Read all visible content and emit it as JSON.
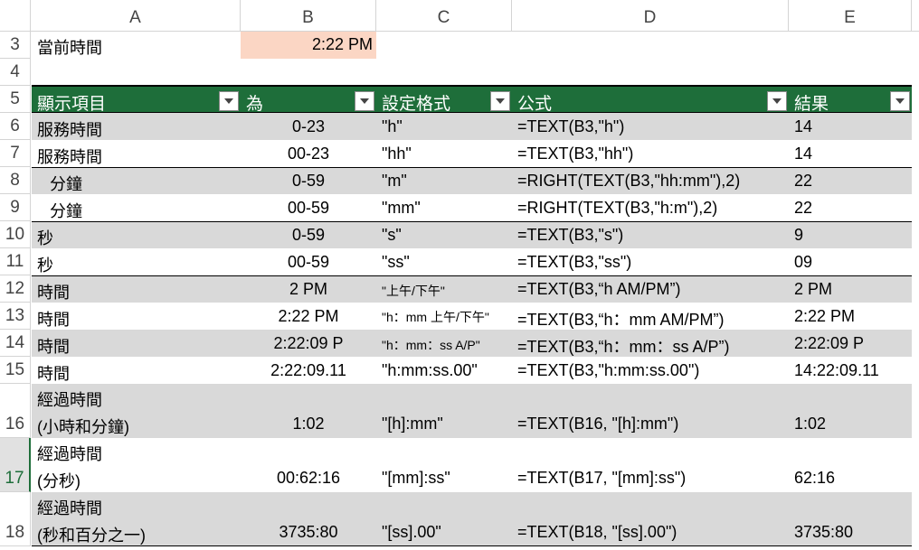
{
  "columns": [
    "A",
    "B",
    "C",
    "D",
    "E"
  ],
  "rows": {
    "r3": {
      "num": "3",
      "label": "當前時間",
      "value": "2:22 PM"
    },
    "r4": {
      "num": "4"
    },
    "r5": {
      "num": "5"
    },
    "header": [
      "顯示項目",
      "為",
      "設定格式",
      "公式",
      "結果"
    ],
    "data": [
      {
        "num": "6",
        "a": "服務時間",
        "b": "0-23",
        "c": "\"h\"",
        "d": "=TEXT(B3,\"h\")",
        "e": "14"
      },
      {
        "num": "7",
        "a": "服務時間",
        "b": "00-23",
        "c": "\"hh\"",
        "d": "=TEXT(B3,\"hh\")",
        "e": "14"
      },
      {
        "num": "8",
        "a": "分鐘",
        "b": "0-59",
        "c": "\"m\"",
        "d": "=RIGHT(TEXT(B3,\"hh:mm\"),2)",
        "e": "22"
      },
      {
        "num": "9",
        "a": "分鐘",
        "b": "00-59",
        "c": "\"mm\"",
        "d": "=RIGHT(TEXT(B3,\"h:m\"),2)",
        "e": "22"
      },
      {
        "num": "10",
        "a": "秒",
        "b": "0-59",
        "c": "\"s\"",
        "d": "=TEXT(B3,\"s\")",
        "e": "9"
      },
      {
        "num": "11",
        "a": "秒",
        "b": "00-59",
        "c": "\"ss\"",
        "d": "=TEXT(B3,\"ss\")",
        "e": "09"
      },
      {
        "num": "12",
        "a": "時間",
        "b": "2 PM",
        "c": "\"上午/下午\"",
        "d": "=TEXT(B3,“h AM/PM”)",
        "e": "2 PM"
      },
      {
        "num": "13",
        "a": "時間",
        "b": "2:22 PM",
        "c": "\"h：mm 上午/下午\"",
        "d": "=TEXT(B3,“h：mm AM/PM”)",
        "e": "2:22 PM"
      },
      {
        "num": "14",
        "a": "時間",
        "b": "2:22:09 P",
        "c": "\"h：mm：ss A/P\"",
        "d": "=TEXT(B3,“h：mm：ss A/P”)",
        "e": "2:22:09 P"
      },
      {
        "num": "15",
        "a": "時間",
        "b": "2:22:09.11",
        "c": "\"h:mm:ss.00\"",
        "d": "=TEXT(B3,\"h:mm:ss.00\")",
        "e": "14:22:09.11"
      },
      {
        "num": "16",
        "a1": "經過時間",
        "a2": "(小時和分鐘)",
        "b": "1:02",
        "c": "\"[h]:mm\"",
        "d": "=TEXT(B16, \"[h]:mm\")",
        "e": "1:02"
      },
      {
        "num": "17",
        "a1": "經過時間",
        "a2": "(分秒)",
        "b": "00:62:16",
        "c": "\"[mm]:ss\"",
        "d": "=TEXT(B17, \"[mm]:ss\")",
        "e": "62:16"
      },
      {
        "num": "18",
        "a1": "經過時間",
        "a2": "(秒和百分之一)",
        "b": "3735:80",
        "c": "\"[ss].00\"",
        "d": "=TEXT(B18, \"[ss].00\")",
        "e": "3735:80"
      }
    ]
  }
}
